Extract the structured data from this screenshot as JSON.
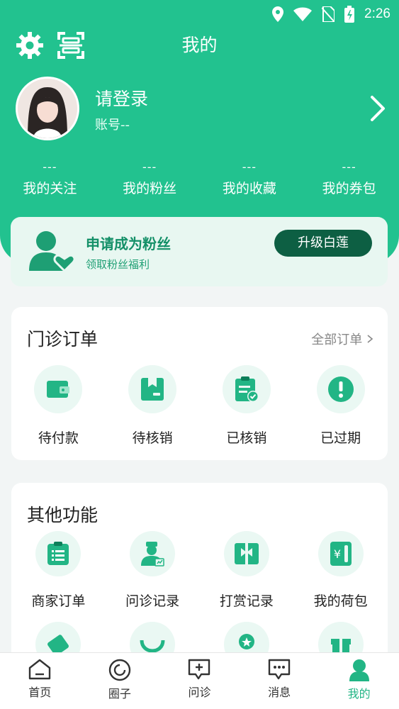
{
  "status": {
    "time": "2:26"
  },
  "header": {
    "title": "我的"
  },
  "profile": {
    "login": "请登录",
    "account": "账号--"
  },
  "stats": [
    {
      "value": "---",
      "label": "我的关注"
    },
    {
      "value": "---",
      "label": "我的粉丝"
    },
    {
      "value": "---",
      "label": "我的收藏"
    },
    {
      "value": "---",
      "label": "我的券包"
    }
  ],
  "fan_banner": {
    "title": "申请成为粉丝",
    "subtitle": "领取粉丝福利",
    "button": "升级白莲"
  },
  "orders": {
    "title": "门诊订单",
    "link": "全部订单",
    "items": [
      {
        "label": "待付款",
        "icon": "wallet-icon"
      },
      {
        "label": "待核销",
        "icon": "package-icon"
      },
      {
        "label": "已核销",
        "icon": "clipboard-check-icon"
      },
      {
        "label": "已过期",
        "icon": "alert-icon"
      }
    ]
  },
  "features": {
    "title": "其他功能",
    "items": [
      {
        "label": "商家订单",
        "icon": "list-icon"
      },
      {
        "label": "问诊记录",
        "icon": "doctor-icon"
      },
      {
        "label": "打赏记录",
        "icon": "gift-box-icon"
      },
      {
        "label": "我的荷包",
        "icon": "purse-icon"
      }
    ]
  },
  "tabbar": [
    {
      "label": "首页",
      "icon": "home-icon"
    },
    {
      "label": "圈子",
      "icon": "circle-icon"
    },
    {
      "label": "问诊",
      "icon": "consult-icon"
    },
    {
      "label": "消息",
      "icon": "message-icon"
    },
    {
      "label": "我的",
      "icon": "person-icon",
      "active": true
    }
  ],
  "colors": {
    "primary": "#22c28f",
    "dark_button": "#0d5f43",
    "icon_green": "#22b585"
  }
}
